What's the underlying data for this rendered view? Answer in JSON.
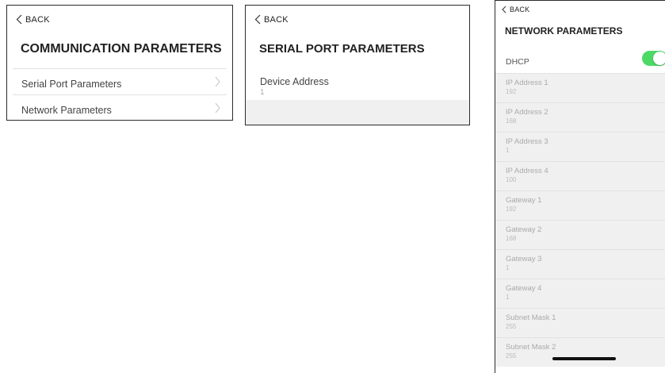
{
  "comm_panel": {
    "back_label": "BACK",
    "title": "COMMUNICATION PARAMETERS",
    "items": [
      {
        "label": "Serial Port Parameters"
      },
      {
        "label": "Network Parameters"
      }
    ]
  },
  "serial_panel": {
    "back_label": "BACK",
    "title": "SERIAL PORT PARAMETERS",
    "device_address": {
      "label": "Device Address",
      "value": "1"
    }
  },
  "network_panel": {
    "back_label": "BACK",
    "title": "NETWORK PARAMETERS",
    "dhcp": {
      "label": "DHCP",
      "enabled": true
    },
    "items": [
      {
        "label": "IP Address 1",
        "value": "192"
      },
      {
        "label": "IP Address 2",
        "value": "168"
      },
      {
        "label": "IP Address 3",
        "value": "1"
      },
      {
        "label": "IP Address 4",
        "value": "100"
      },
      {
        "label": "Gateway 1",
        "value": "192"
      },
      {
        "label": "Gateway 2",
        "value": "168"
      },
      {
        "label": "Gateway 3",
        "value": "1"
      },
      {
        "label": "Gateway 4",
        "value": "1"
      },
      {
        "label": "Subnet Mask 1",
        "value": "255"
      },
      {
        "label": "Subnet Mask 2",
        "value": "255"
      }
    ]
  },
  "icons": {
    "back": "chevron-left-icon",
    "row_arrow": "chevron-right-icon"
  },
  "colors": {
    "toggle_on": "#4cd964",
    "panel_border": "#2b2b2b",
    "disabled_text": "#aaaaaa"
  }
}
